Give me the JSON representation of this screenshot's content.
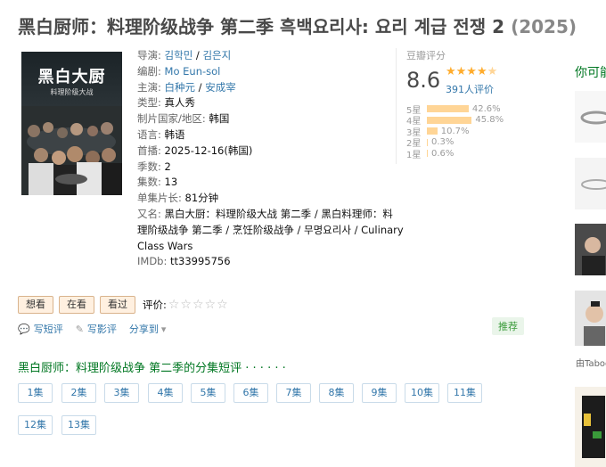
{
  "title": {
    "main": "黑白厨师：料理阶级战争 第二季 흑백요리사: 요리 계급 전쟁 2",
    "year": "(2025)"
  },
  "poster": {
    "title": "黑白大厨",
    "subtitle": "料理阶级大战"
  },
  "info": {
    "director_label": "导演:",
    "directors": [
      "김학민",
      "김은지"
    ],
    "writer_label": "编剧:",
    "writer": "Mo Eun-sol",
    "cast_label": "主演:",
    "cast": [
      "白种元",
      "安成宰"
    ],
    "genre_label": "类型:",
    "genre": "真人秀",
    "country_label": "制片国家/地区:",
    "country": "韩国",
    "language_label": "语言:",
    "language": "韩语",
    "premiere_label": "首播:",
    "premiere": "2025-12-16(韩国)",
    "seasons_label": "季数:",
    "seasons": "2",
    "episodes_label": "集数:",
    "episodes": "13",
    "runtime_label": "单集片长:",
    "runtime": "81分钟",
    "aka_label": "又名:",
    "aka_line1": "黑白大厨：料理阶级大战 第二季 / 黑白料理师：料",
    "aka_line2": "理阶级战争 第二季 / 烹饪阶级战争 / 무명요리사 / Culinary",
    "aka_line3": "Class Wars",
    "imdb_label": "IMDb:",
    "imdb": "tt33995756"
  },
  "rating": {
    "label": "豆瓣评分",
    "score": "8.6",
    "stars": 4.5,
    "count": "391人评价",
    "rows": [
      {
        "label": "5星",
        "pct": "42.6%",
        "value": 42.6
      },
      {
        "label": "4星",
        "pct": "45.8%",
        "value": 45.8
      },
      {
        "label": "3星",
        "pct": "10.7%",
        "value": 10.7
      },
      {
        "label": "2星",
        "pct": "0.3%",
        "value": 0.3
      },
      {
        "label": "1星",
        "pct": "0.6%",
        "value": 0.6
      }
    ]
  },
  "sidebar": {
    "heading": "你可能",
    "caption": "由Taboo"
  },
  "buttons": {
    "want": "想看",
    "watching": "在看",
    "watched": "看过",
    "rate_label": "评价:"
  },
  "actions": {
    "short_review": "写短评",
    "review": "写影评",
    "share": "分享到",
    "recommend": "推荐"
  },
  "episodes_section": {
    "heading": "黑白厨师：料理阶级战争 第二季的分集短评",
    "dots": " · · · · · ·",
    "items": [
      "1集",
      "2集",
      "3集",
      "4集",
      "5集",
      "6集",
      "7集",
      "8集",
      "9集",
      "10集",
      "11集",
      "12集",
      "13集"
    ]
  },
  "colors": {
    "link": "#3377aa",
    "green": "#007722",
    "star": "#ffac2d"
  }
}
